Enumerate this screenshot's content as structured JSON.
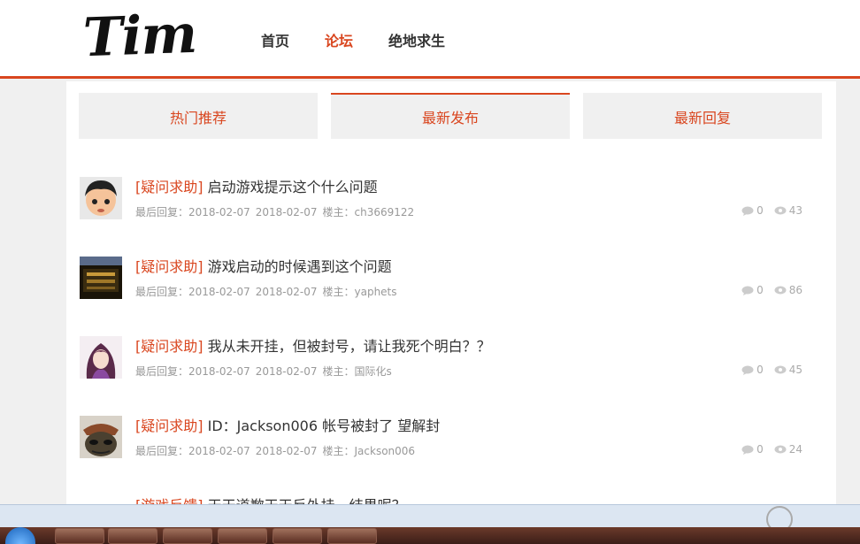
{
  "header": {
    "logo": "Tim",
    "nav": [
      {
        "label": "首页",
        "active": false
      },
      {
        "label": "论坛",
        "active": true
      },
      {
        "label": "绝地求生",
        "active": false
      }
    ]
  },
  "tabs": [
    {
      "label": "热门推荐",
      "active": false
    },
    {
      "label": "最新发布",
      "active": true
    },
    {
      "label": "最新回复",
      "active": false
    }
  ],
  "posts": [
    {
      "tag": "[疑问求助]",
      "title": "启动游戏提示这个什么问题",
      "last_reply": "最后回复：2018-02-07",
      "date": "2018-02-07",
      "author": "楼主：ch3669122",
      "comments": "0",
      "views": "43"
    },
    {
      "tag": "[疑问求助]",
      "title": "游戏启动的时候遇到这个问题",
      "last_reply": "最后回复：2018-02-07",
      "date": "2018-02-07",
      "author": "楼主：yaphets",
      "comments": "0",
      "views": "86"
    },
    {
      "tag": "[疑问求助]",
      "title": "我从未开挂，但被封号，请让我死个明白？？",
      "last_reply": "最后回复：2018-02-07",
      "date": "2018-02-07",
      "author": "楼主：国际化s",
      "comments": "0",
      "views": "45"
    },
    {
      "tag": "[疑问求助]",
      "title": "ID：Jackson006 帐号被封了 望解封",
      "last_reply": "最后回复：2018-02-07",
      "date": "2018-02-07",
      "author": "楼主：Jackson006",
      "comments": "0",
      "views": "24"
    },
    {
      "tag": "[游戏反馈]",
      "title": "天天道歉天天反外挂，结果呢？",
      "last_reply": "",
      "date": "",
      "author": "",
      "comments": "",
      "views": ""
    }
  ],
  "colors": {
    "accent": "#d9461f",
    "page_bg": "#f0f0f0"
  }
}
